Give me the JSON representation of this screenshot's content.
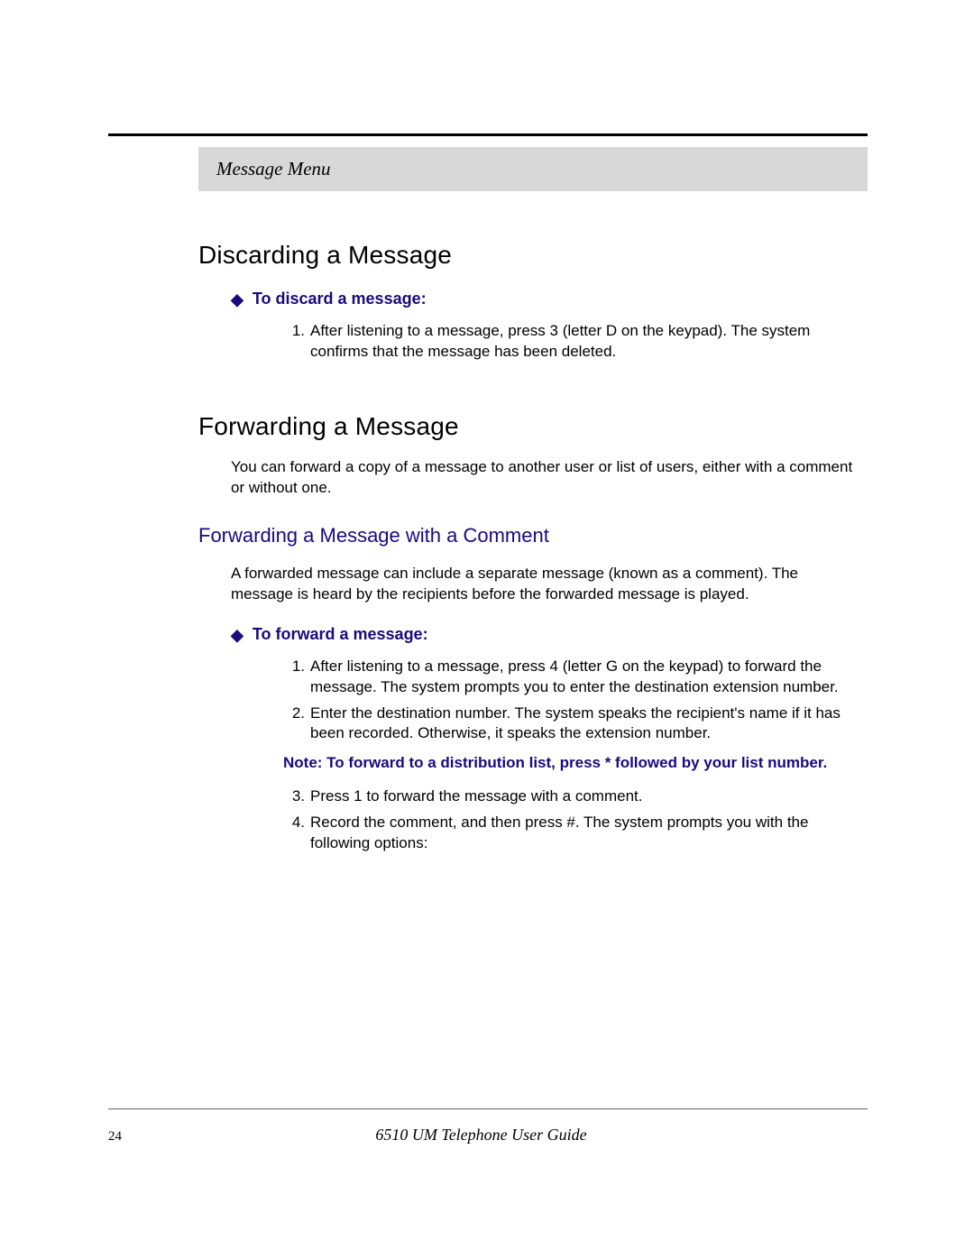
{
  "header": {
    "section": "Message Menu"
  },
  "section1": {
    "heading": "Discarding a Message",
    "task_label": "To discard a message:",
    "steps": [
      "After listening to a message, press 3 (letter D on the keypad). The system confirms that the message has been deleted."
    ]
  },
  "section2": {
    "heading": "Forwarding a Message",
    "intro": "You can forward a copy of a message to another user or list of users, either with a comment or without one.",
    "sub_heading": "Forwarding a Message with a Comment",
    "sub_intro": "A forwarded message can include a separate message (known as a comment). The message is heard by the recipients before the forwarded message is played.",
    "task_label": "To forward a message:",
    "steps_a": [
      "After listening to a message, press 4 (letter G on the keypad) to forward the message. The system prompts you to enter the destination extension number.",
      "Enter the destination number. The system speaks the recipient's name if it has been recorded. Otherwise, it speaks the extension number."
    ],
    "note": "Note: To forward to a distribution list, press * followed by your list number.",
    "steps_b": [
      "Press 1 to forward the message with a comment.",
      "Record the comment, and then press #. The system prompts you with the following options:"
    ]
  },
  "footer": {
    "page": "24",
    "title": "6510 UM Telephone User Guide"
  }
}
